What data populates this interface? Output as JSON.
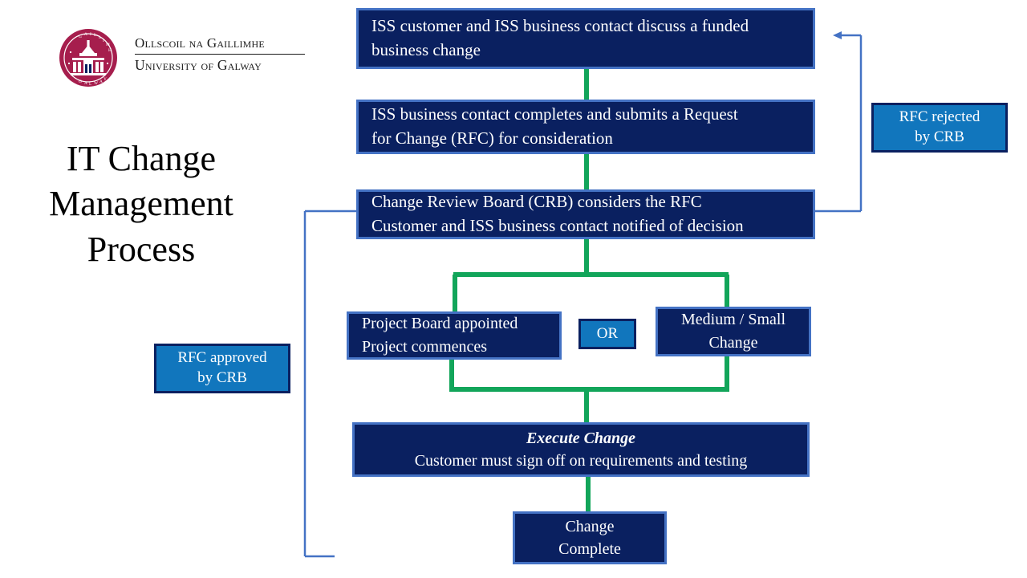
{
  "branding": {
    "crest_icon": "university-crest-icon",
    "crest_color": "#a61e4d",
    "wordmark_irish": "Ollscoil na Gaillimhe",
    "wordmark_english": "University of Galway",
    "crest_text_outer": "GAILLIMH",
    "crest_text_inner": "GALWAY"
  },
  "slide": {
    "title": "IT Change Management Process"
  },
  "palette": {
    "node_fill": "#0a2060",
    "node_border": "#4472c4",
    "callout_fill": "#1176bd",
    "callout_border": "#0a2060",
    "flow_green": "#12a55a",
    "loop_blue": "#4472c4",
    "text_light": "#ffffff",
    "text_dark": "#000000"
  },
  "flow": {
    "type": "flowchart",
    "nodes": [
      {
        "id": "discuss",
        "lines": [
          "ISS  customer and ISS  business contact discuss a funded",
          "business change"
        ],
        "align": "left"
      },
      {
        "id": "submit",
        "lines": [
          "ISS  business contact completes and submits  a Request",
          "for Change (RFC) for consideration"
        ],
        "align": "left"
      },
      {
        "id": "crb",
        "lines": [
          "Change Review Board (CRB) considers the RFC",
          "Customer and ISS  business contact notified of decision"
        ],
        "align": "left"
      },
      {
        "id": "project",
        "lines": [
          "Project Board appointed",
          "Project commences"
        ],
        "align": "left"
      },
      {
        "id": "medium",
        "lines": [
          "Medium / Small",
          "Change"
        ],
        "align": "center"
      },
      {
        "id": "execute",
        "lines": [
          "Execute Change",
          "Customer must sign off on requirements and testing"
        ],
        "align": "center",
        "emphasis_first_line": true
      },
      {
        "id": "complete",
        "lines": [
          "Change",
          "Complete"
        ],
        "align": "center"
      }
    ],
    "callouts": [
      {
        "id": "rejected",
        "lines": [
          "RFC rejected",
          "by CRB"
        ]
      },
      {
        "id": "approved",
        "lines": [
          "RFC approved",
          "by CRB"
        ]
      }
    ],
    "badges": [
      {
        "id": "or",
        "label": "OR"
      }
    ],
    "edges": [
      {
        "from": "discuss",
        "to": "submit",
        "color": "#12a55a",
        "style": "straight"
      },
      {
        "from": "submit",
        "to": "crb",
        "color": "#12a55a",
        "style": "straight"
      },
      {
        "from": "crb",
        "to": "project",
        "color": "#12a55a",
        "style": "split-left"
      },
      {
        "from": "crb",
        "to": "medium",
        "color": "#12a55a",
        "style": "split-right"
      },
      {
        "from": "project",
        "to": "execute",
        "color": "#12a55a",
        "style": "merge-left"
      },
      {
        "from": "medium",
        "to": "execute",
        "color": "#12a55a",
        "style": "merge-right"
      },
      {
        "from": "execute",
        "to": "complete",
        "color": "#12a55a",
        "style": "straight"
      },
      {
        "from": "crb",
        "to": "discuss",
        "color": "#4472c4",
        "style": "loop-right-arrow",
        "label": "RFC rejected by CRB"
      },
      {
        "from": "crb",
        "to": "complete",
        "color": "#4472c4",
        "style": "loop-left",
        "label": "RFC approved by CRB"
      }
    ]
  }
}
